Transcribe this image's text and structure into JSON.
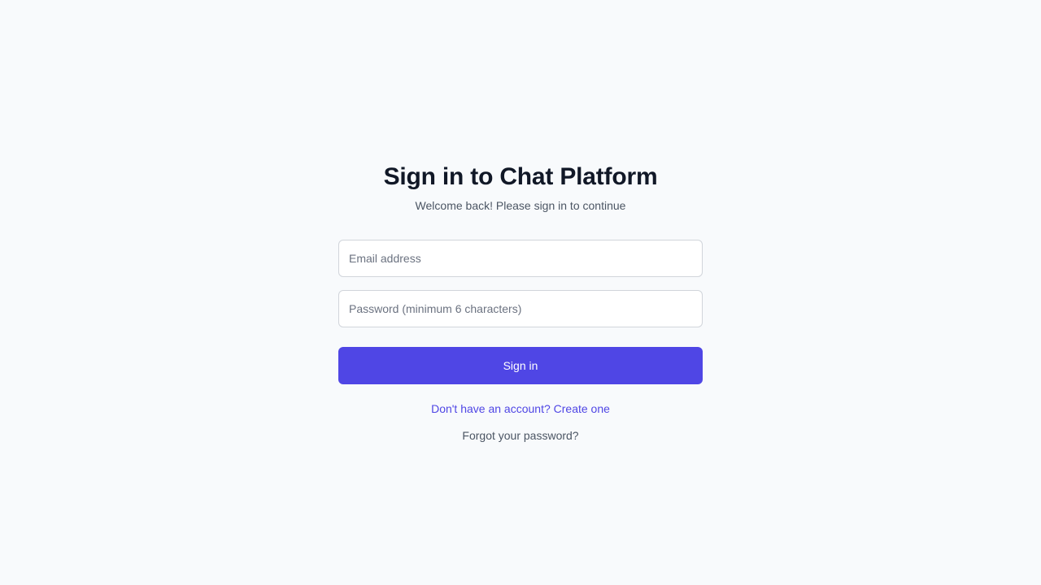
{
  "header": {
    "title": "Sign in to Chat Platform",
    "subtitle": "Welcome back! Please sign in to continue"
  },
  "form": {
    "email": {
      "value": "",
      "placeholder": "Email address"
    },
    "password": {
      "value": "",
      "placeholder": "Password (minimum 6 characters)"
    },
    "submit_label": "Sign in"
  },
  "links": {
    "create_account": "Don't have an account? Create one",
    "forgot_password": "Forgot your password?"
  },
  "colors": {
    "background": "#f8fafc",
    "accent": "#4f46e5",
    "title": "#111827",
    "muted": "#4b5563",
    "input_border": "#d1d5db"
  }
}
